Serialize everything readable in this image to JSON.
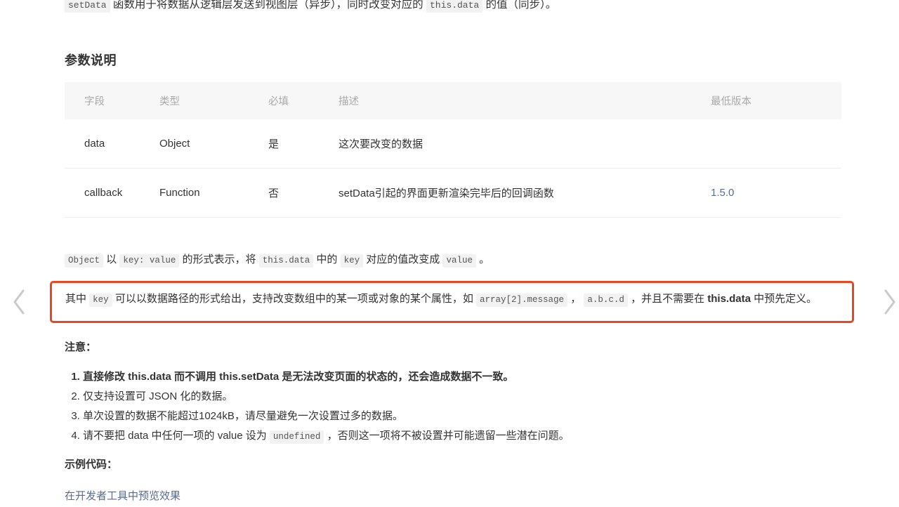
{
  "intro": {
    "code_1": "setData",
    "text_1": " 函数用于将数据从逻辑层发送到视图层（异步），同时改变对应的 ",
    "code_2": "this.data",
    "text_2": " 的值（同步）。"
  },
  "section": {
    "params_title": "参数说明"
  },
  "table": {
    "headers": [
      "字段",
      "类型",
      "必填",
      "描述",
      "最低版本"
    ],
    "rows": [
      {
        "field": "data",
        "type": "Object",
        "required": "是",
        "description": "这次要改变的数据",
        "version": ""
      },
      {
        "field": "callback",
        "type": "Function",
        "required": "否",
        "description": "setData引起的界面更新渲染完毕后的回调函数",
        "version": "1.5.0"
      }
    ]
  },
  "object_para": {
    "code_object": "Object",
    "text_1": " 以 ",
    "code_keyvalue": "key: value",
    "text_2": " 的形式表示，将 ",
    "code_thisdata": "this.data",
    "text_3": " 中的 ",
    "code_key": "key",
    "text_4": " 对应的值改变成 ",
    "code_value": "value",
    "text_5": " 。"
  },
  "highlight": {
    "text_1": "其中 ",
    "code_key": "key",
    "text_2": " 可以以数据路径的形式给出，支持改变数组中的某一项或对象的某个属性，如 ",
    "code_array": "array[2].message",
    "text_3": " ， ",
    "code_abcd": "a.b.c.d",
    "text_4": " ，并且不需要在 ",
    "strong_thisdata": "this.data",
    "text_5": " 中预先定义。",
    "border_color": "#e8471f"
  },
  "nav": {
    "prev_label": "chevron-left",
    "next_label": "chevron-right"
  },
  "notice": {
    "title": "注意：",
    "items": [
      "直接修改 this.data 而不调用 this.setData 是无法改变页面的状态的，还会造成数据不一致。",
      "仅支持设置可 JSON 化的数据。",
      "单次设置的数据不能超过1024kB，请尽量避免一次设置过多的数据。"
    ],
    "item4": {
      "text_1": "请不要把 data 中任何一项的 value 设为 ",
      "code": "undefined",
      "text_2": " ，否则这一项将不被设置并可能遗留一些潜在问题。"
    }
  },
  "example": {
    "title": "示例代码：",
    "link": "在开发者工具中预览效果",
    "link_color": "#576b95"
  }
}
